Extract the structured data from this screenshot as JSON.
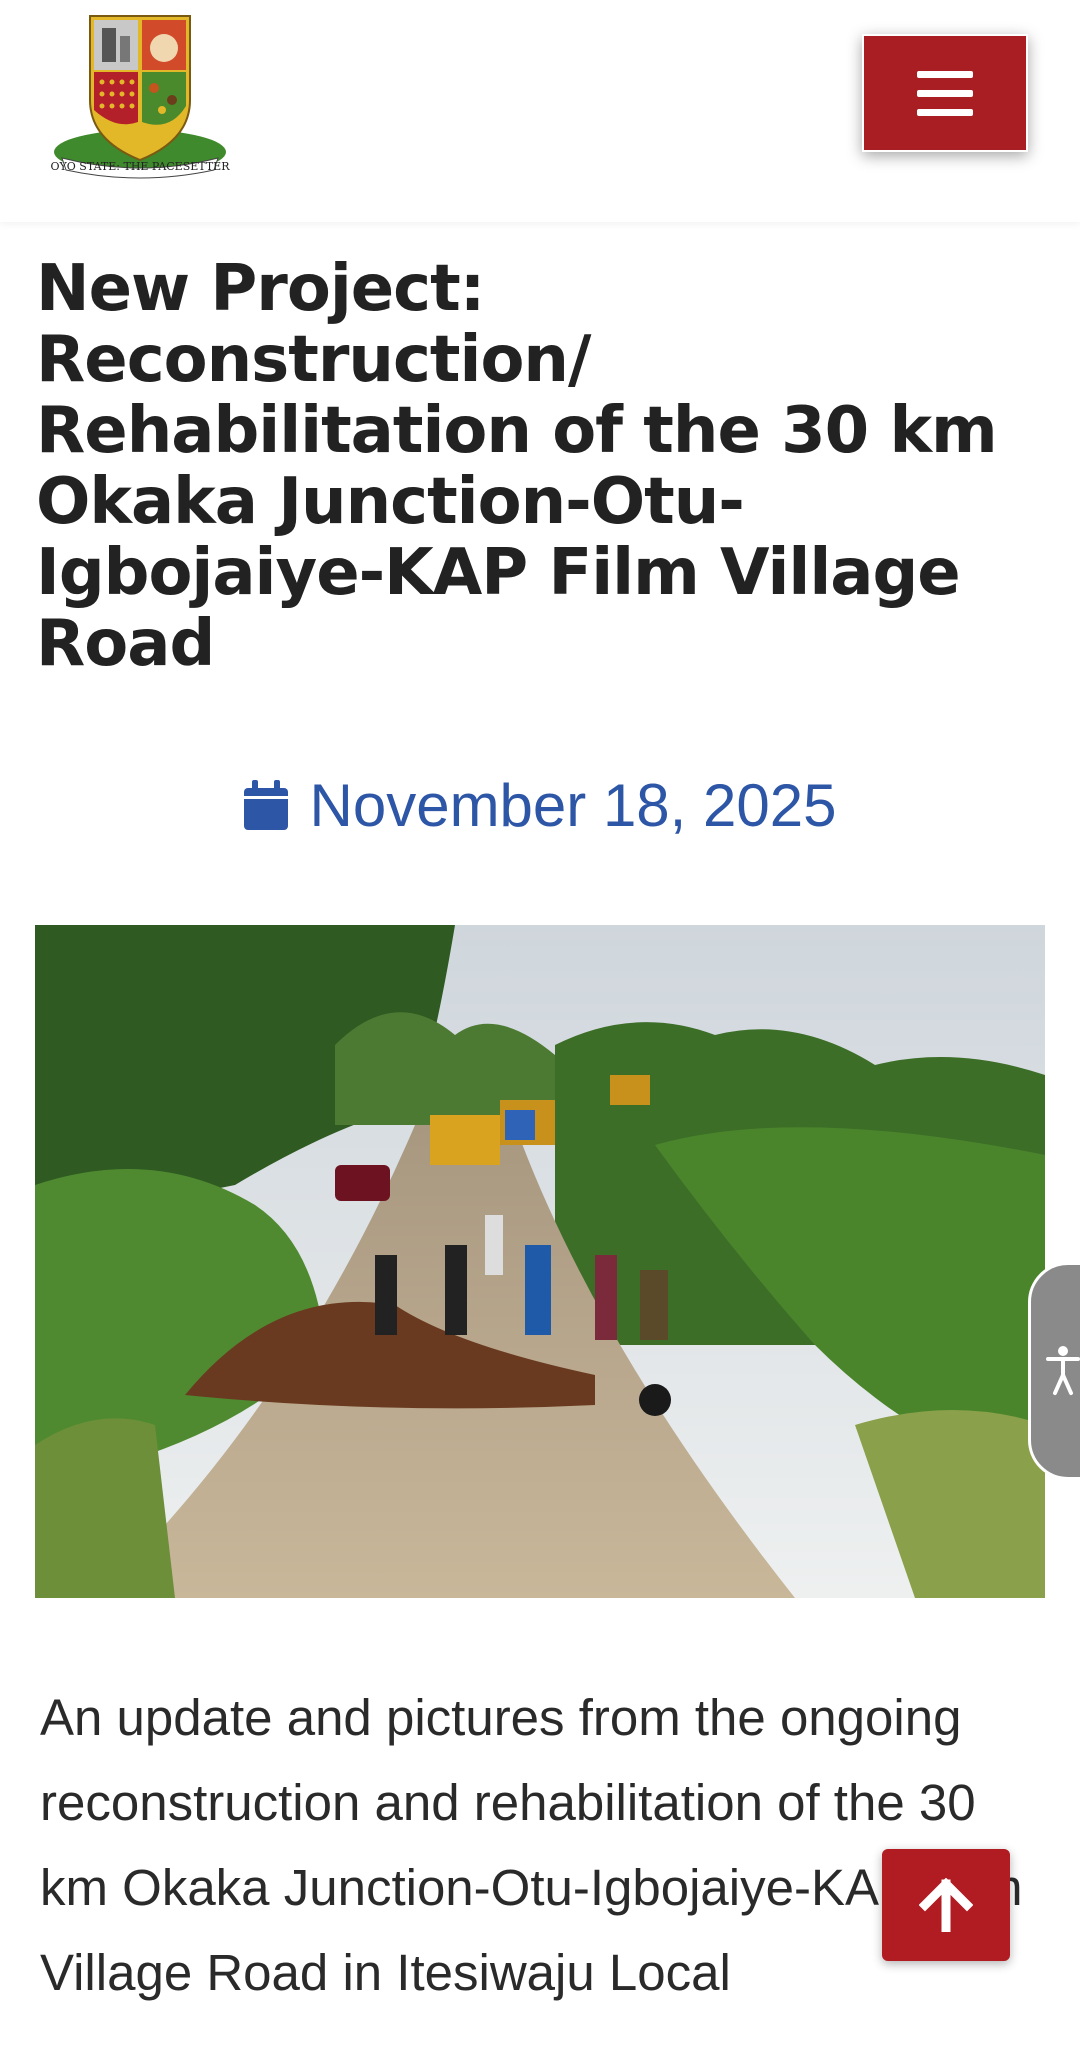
{
  "header": {
    "logo_motto": "OYO STATE: THE PACESETTER",
    "menu_icon": "hamburger-menu-icon",
    "menu_color": "#a91e22"
  },
  "article": {
    "title": "New Project: Reconstruction/ Rehabilitation of the 30 km Okaka Junction-Otu-Igbojaiye-KAP Film Village Road",
    "date": "November 18, 2025",
    "date_icon": "calendar-icon",
    "date_color": "#2d56a6",
    "body": "An update and pictures from the ongoing reconstruction and rehabilitation of the 30 km Okaka Junction-Otu-Igbojaiye-KAP Film Village Road in Itesiwaju Local"
  },
  "floating": {
    "accessibility_icon": "accessibility-person-icon",
    "back_to_top_icon": "arrow-up-icon",
    "back_to_top_color": "#b01c22"
  }
}
